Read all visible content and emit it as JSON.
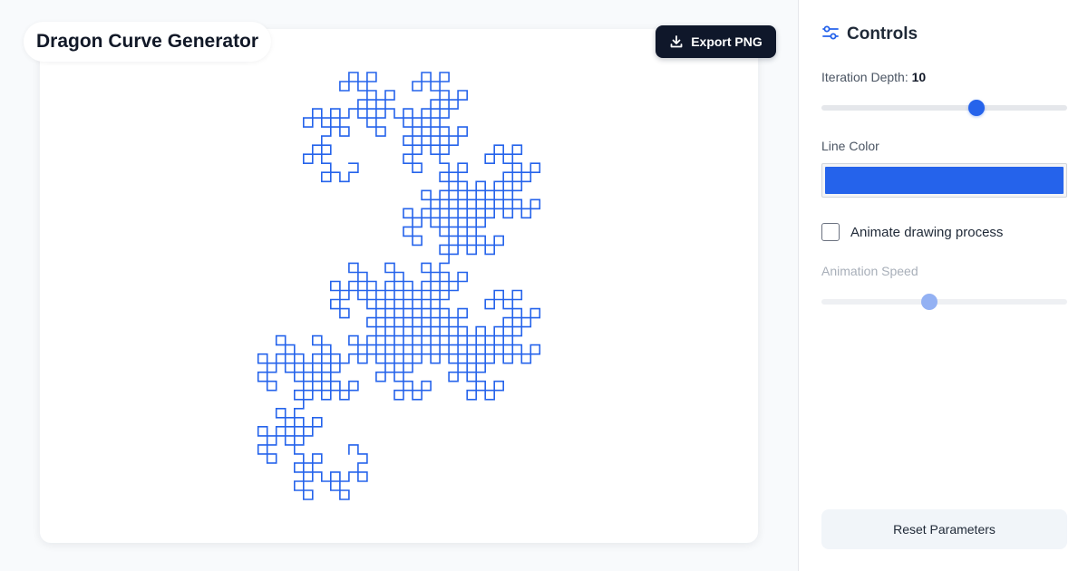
{
  "app": {
    "title": "Dragon Curve Generator",
    "export_label": "Export PNG"
  },
  "curve": {
    "iterations": 10,
    "color": "#2563eb"
  },
  "controls": {
    "title": "Controls",
    "iteration": {
      "label": "Iteration Depth:",
      "value": "10",
      "fraction": 0.63
    },
    "line_color": {
      "label": "Line Color",
      "value": "#2563eb"
    },
    "animate": {
      "label": "Animate drawing process",
      "checked": false
    },
    "speed": {
      "label": "Animation Speed",
      "fraction": 0.44,
      "disabled": true
    },
    "reset_label": "Reset Parameters"
  },
  "icons": {
    "export": "download-icon",
    "controls": "sliders-icon"
  }
}
